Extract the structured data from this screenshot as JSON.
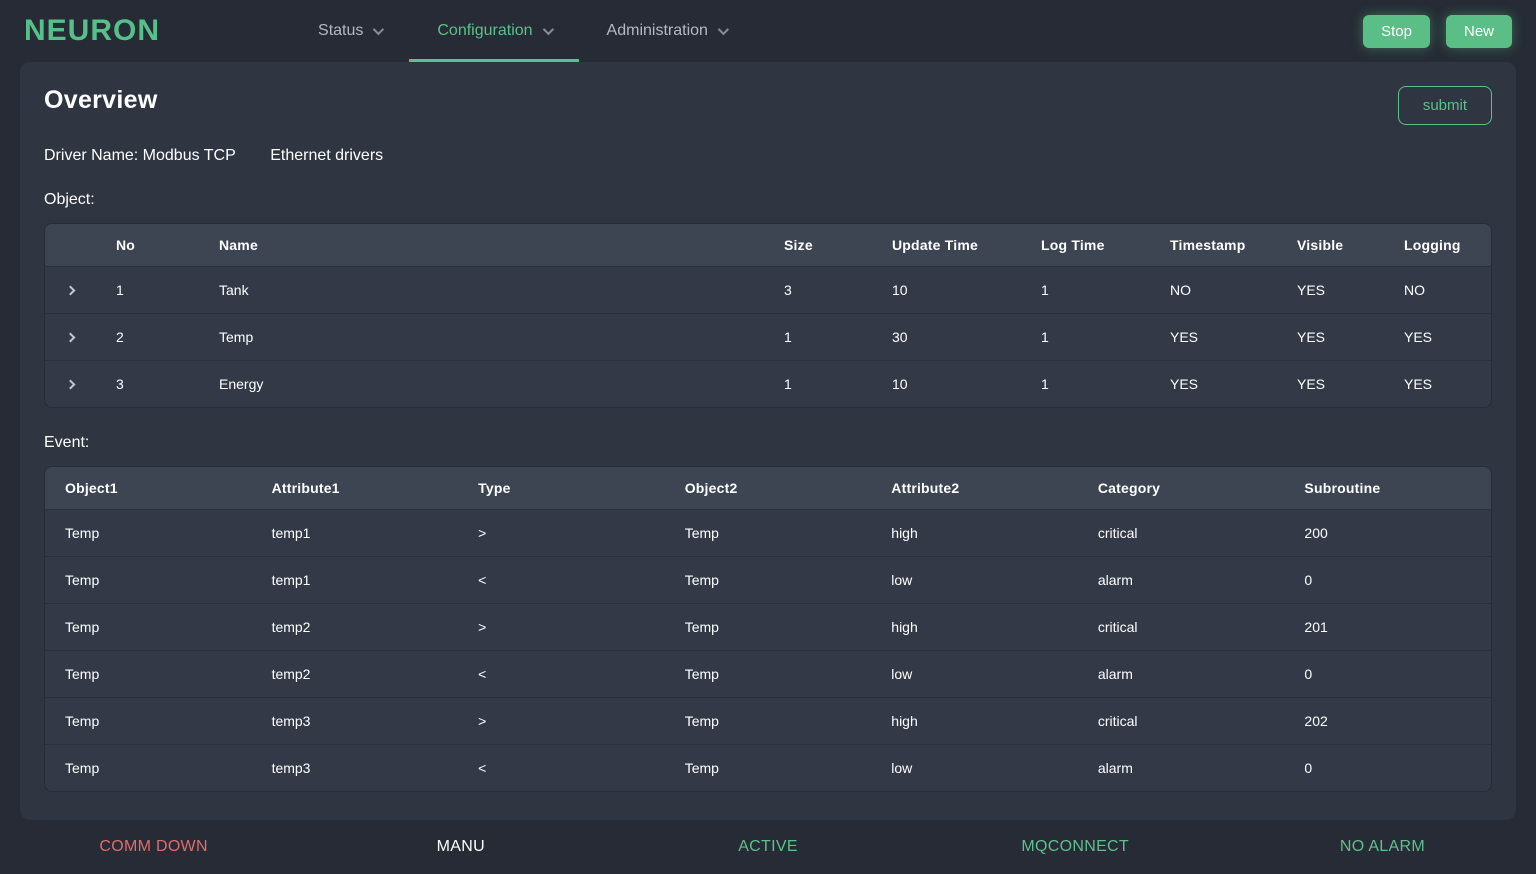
{
  "colors": {
    "accent": "#5ec08b",
    "danger": "#e06c6c",
    "card_bg": "#2f3541",
    "page_bg": "#262b35"
  },
  "nav": {
    "brand": "NEURON",
    "items": [
      {
        "label": "Status",
        "active": false
      },
      {
        "label": "Configuration",
        "active": true
      },
      {
        "label": "Administration",
        "active": false
      }
    ],
    "stop_label": "Stop",
    "new_label": "New"
  },
  "overview": {
    "title": "Overview",
    "submit_label": "submit",
    "driver_name": "Driver Name: Modbus TCP",
    "driver_type": "Ethernet drivers",
    "object_section_label": "Object:",
    "event_section_label": "Event:"
  },
  "object_table": {
    "headers": [
      "No",
      "Name",
      "Size",
      "Update Time",
      "Log Time",
      "Timestamp",
      "Visible",
      "Logging"
    ],
    "rows": [
      {
        "no": "1",
        "name": "Tank",
        "size": "3",
        "update_time": "10",
        "log_time": "1",
        "timestamp": "NO",
        "visible": "YES",
        "logging": "NO"
      },
      {
        "no": "2",
        "name": "Temp",
        "size": "1",
        "update_time": "30",
        "log_time": "1",
        "timestamp": "YES",
        "visible": "YES",
        "logging": "YES"
      },
      {
        "no": "3",
        "name": "Energy",
        "size": "1",
        "update_time": "10",
        "log_time": "1",
        "timestamp": "YES",
        "visible": "YES",
        "logging": "YES"
      }
    ]
  },
  "event_table": {
    "headers": [
      "Object1",
      "Attribute1",
      "Type",
      "Object2",
      "Attribute2",
      "Category",
      "Subroutine"
    ],
    "rows": [
      {
        "object1": "Temp",
        "attribute1": "temp1",
        "type": ">",
        "object2": "Temp",
        "attribute2": "high",
        "category": "critical",
        "subroutine": "200"
      },
      {
        "object1": "Temp",
        "attribute1": "temp1",
        "type": "<",
        "object2": "Temp",
        "attribute2": "low",
        "category": "alarm",
        "subroutine": "0"
      },
      {
        "object1": "Temp",
        "attribute1": "temp2",
        "type": ">",
        "object2": "Temp",
        "attribute2": "high",
        "category": "critical",
        "subroutine": "201"
      },
      {
        "object1": "Temp",
        "attribute1": "temp2",
        "type": "<",
        "object2": "Temp",
        "attribute2": "low",
        "category": "alarm",
        "subroutine": "0"
      },
      {
        "object1": "Temp",
        "attribute1": "temp3",
        "type": ">",
        "object2": "Temp",
        "attribute2": "high",
        "category": "critical",
        "subroutine": "202"
      },
      {
        "object1": "Temp",
        "attribute1": "temp3",
        "type": "<",
        "object2": "Temp",
        "attribute2": "low",
        "category": "alarm",
        "subroutine": "0"
      }
    ]
  },
  "footer": {
    "statuses": [
      {
        "label": "COMM DOWN",
        "color": "#e06c6c"
      },
      {
        "label": "MANU",
        "color": "#ffffff"
      },
      {
        "label": "ACTIVE",
        "color": "#5ec08b"
      },
      {
        "label": "MQCONNECT",
        "color": "#5ec08b"
      },
      {
        "label": "NO ALARM",
        "color": "#5ec08b"
      }
    ]
  }
}
